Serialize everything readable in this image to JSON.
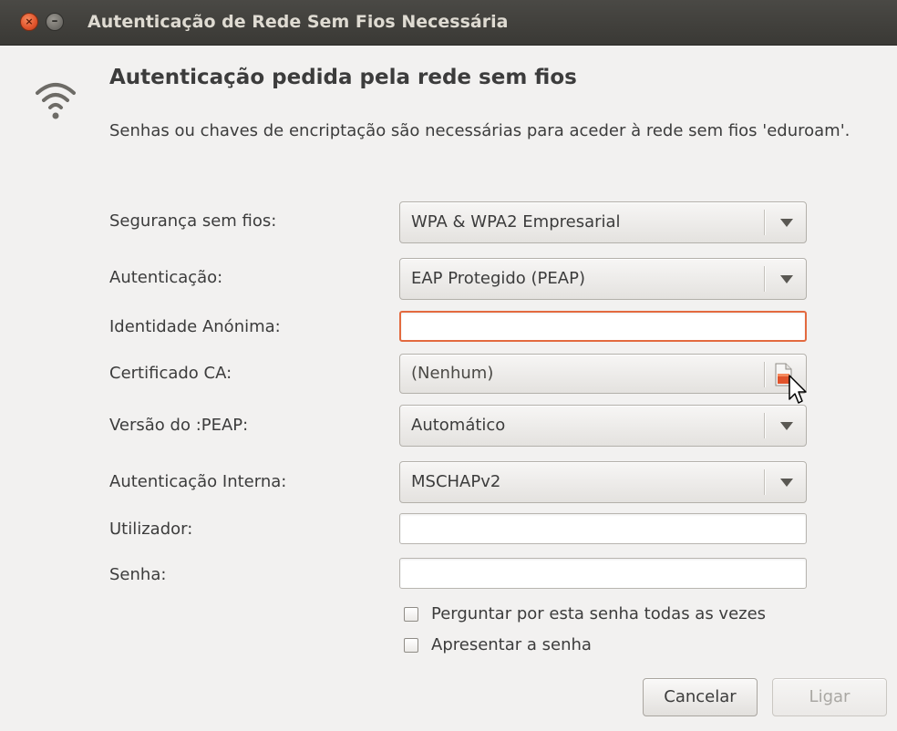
{
  "window": {
    "title": "Autenticação de Rede Sem Fios Necessária",
    "close_glyph": "×",
    "minimize_glyph": "–"
  },
  "icons": {
    "wifi": "wireless-signal-icon",
    "file": "document-open-icon",
    "cursor": "mouse-pointer-icon"
  },
  "colors": {
    "accent": "#e36a3f",
    "titlebar": "#3c3b37",
    "background": "#f2f1f0"
  },
  "dialog": {
    "heading": "Autenticação pedida pela rede sem fios",
    "description": "Senhas ou chaves de encriptação são necessárias para aceder à rede sem fios 'eduroam'."
  },
  "form": {
    "wireless_security": {
      "label": "Segurança sem fios:",
      "value": "WPA & WPA2 Empresarial"
    },
    "authentication": {
      "label": "Autenticação:",
      "value": "EAP Protegido (PEAP)"
    },
    "anonymous_identity": {
      "label": "Identidade Anónima:",
      "value": ""
    },
    "ca_certificate": {
      "label": "Certificado CA:",
      "value": "(Nenhum)"
    },
    "peap_version": {
      "label": "Versão do :PEAP:",
      "value": "Automático"
    },
    "inner_authentication": {
      "label": "Autenticação Interna:",
      "value": "MSCHAPv2"
    },
    "username": {
      "label": "Utilizador:",
      "value": ""
    },
    "password": {
      "label": "Senha:",
      "value": ""
    },
    "ask_password_checkbox": {
      "label": "Perguntar por esta senha todas as vezes",
      "checked": false
    },
    "show_password_checkbox": {
      "label": "Apresentar a senha",
      "checked": false
    }
  },
  "buttons": {
    "cancel": "Cancelar",
    "connect": "Ligar"
  }
}
